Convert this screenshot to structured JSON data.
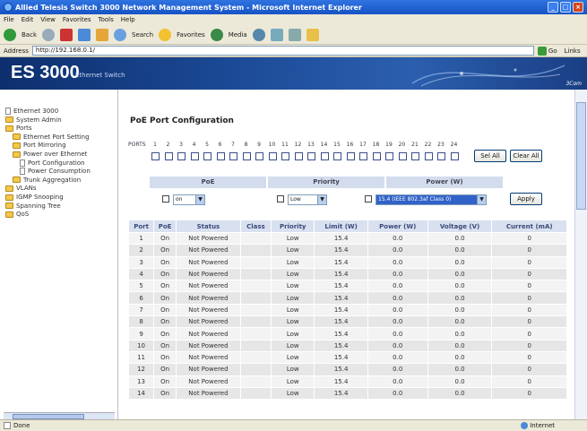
{
  "window": {
    "title": "Allied Telesis Switch 3000 Network Management System - Microsoft Internet Explorer",
    "controls": [
      "_",
      "□",
      "×"
    ]
  },
  "menu": [
    "File",
    "Edit",
    "View",
    "Favorites",
    "Tools",
    "Help"
  ],
  "toolbar": {
    "back": "Back",
    "search": "Search",
    "favorites": "Favorites",
    "media": "Media"
  },
  "address": {
    "label": "Address",
    "url": "http://192.168.0.1/",
    "go": "Go",
    "links": "Links"
  },
  "banner": {
    "brand": "ES 3000",
    "subtitle": "Ethernet Switch",
    "vendor": "3Com"
  },
  "nav": [
    {
      "label": "Ethernet 3000",
      "icon": "page",
      "indent": 0
    },
    {
      "label": "System Admin",
      "icon": "folder",
      "indent": 0
    },
    {
      "label": "Ports",
      "icon": "folder",
      "indent": 0
    },
    {
      "label": "Ethernet Port Setting",
      "icon": "folder",
      "indent": 1
    },
    {
      "label": "Port Mirroring",
      "icon": "folder",
      "indent": 1
    },
    {
      "label": "Power over Ethernet",
      "icon": "folder",
      "indent": 1
    },
    {
      "label": "Port Configuration",
      "icon": "page",
      "indent": 2
    },
    {
      "label": "Power Consumption",
      "icon": "page",
      "indent": 2
    },
    {
      "label": "Trunk Aggregation",
      "icon": "folder",
      "indent": 1
    },
    {
      "label": "VLANs",
      "icon": "folder",
      "indent": 0
    },
    {
      "label": "IGMP Snooping",
      "icon": "folder",
      "indent": 0
    },
    {
      "label": "Spanning Tree",
      "icon": "folder",
      "indent": 0
    },
    {
      "label": "QoS",
      "icon": "folder",
      "indent": 0
    }
  ],
  "page": {
    "title": "PoE Port Configuration",
    "ports_label": "PORTS",
    "port_numbers": [
      "1",
      "2",
      "3",
      "4",
      "5",
      "6",
      "7",
      "8",
      "9",
      "10",
      "11",
      "12",
      "13",
      "14",
      "15",
      "16",
      "17",
      "18",
      "19",
      "20",
      "21",
      "22",
      "23",
      "24"
    ],
    "select_all": "Sel All",
    "clear_all": "Clear All",
    "config": {
      "headers": [
        "PoE",
        "Priority",
        "Power (W)"
      ],
      "poe_value": "on",
      "priority_value": "Low",
      "power_value": "15.4 (IEEE 802.3af Class 0)",
      "apply": "Apply"
    },
    "table": {
      "headers": [
        "Port",
        "PoE",
        "Status",
        "Class",
        "Priority",
        "Limit (W)",
        "Power (W)",
        "Voltage (V)",
        "Current (mA)"
      ],
      "rows": [
        [
          "1",
          "On",
          "Not Powered",
          "",
          "Low",
          "15.4",
          "0.0",
          "0.0",
          "0"
        ],
        [
          "2",
          "On",
          "Not Powered",
          "",
          "Low",
          "15.4",
          "0.0",
          "0.0",
          "0"
        ],
        [
          "3",
          "On",
          "Not Powered",
          "",
          "Low",
          "15.4",
          "0.0",
          "0.0",
          "0"
        ],
        [
          "4",
          "On",
          "Not Powered",
          "",
          "Low",
          "15.4",
          "0.0",
          "0.0",
          "0"
        ],
        [
          "5",
          "On",
          "Not Powered",
          "",
          "Low",
          "15.4",
          "0.0",
          "0.0",
          "0"
        ],
        [
          "6",
          "On",
          "Not Powered",
          "",
          "Low",
          "15.4",
          "0.0",
          "0.0",
          "0"
        ],
        [
          "7",
          "On",
          "Not Powered",
          "",
          "Low",
          "15.4",
          "0.0",
          "0.0",
          "0"
        ],
        [
          "8",
          "On",
          "Not Powered",
          "",
          "Low",
          "15.4",
          "0.0",
          "0.0",
          "0"
        ],
        [
          "9",
          "On",
          "Not Powered",
          "",
          "Low",
          "15.4",
          "0.0",
          "0.0",
          "0"
        ],
        [
          "10",
          "On",
          "Not Powered",
          "",
          "Low",
          "15.4",
          "0.0",
          "0.0",
          "0"
        ],
        [
          "11",
          "On",
          "Not Powered",
          "",
          "Low",
          "15.4",
          "0.0",
          "0.0",
          "0"
        ],
        [
          "12",
          "On",
          "Not Powered",
          "",
          "Low",
          "15.4",
          "0.0",
          "0.0",
          "0"
        ],
        [
          "13",
          "On",
          "Not Powered",
          "",
          "Low",
          "15.4",
          "0.0",
          "0.0",
          "0"
        ],
        [
          "14",
          "On",
          "Not Powered",
          "",
          "Low",
          "15.4",
          "0.0",
          "0.0",
          "0"
        ]
      ]
    }
  },
  "status": {
    "left": "Done",
    "zone": "Internet"
  }
}
